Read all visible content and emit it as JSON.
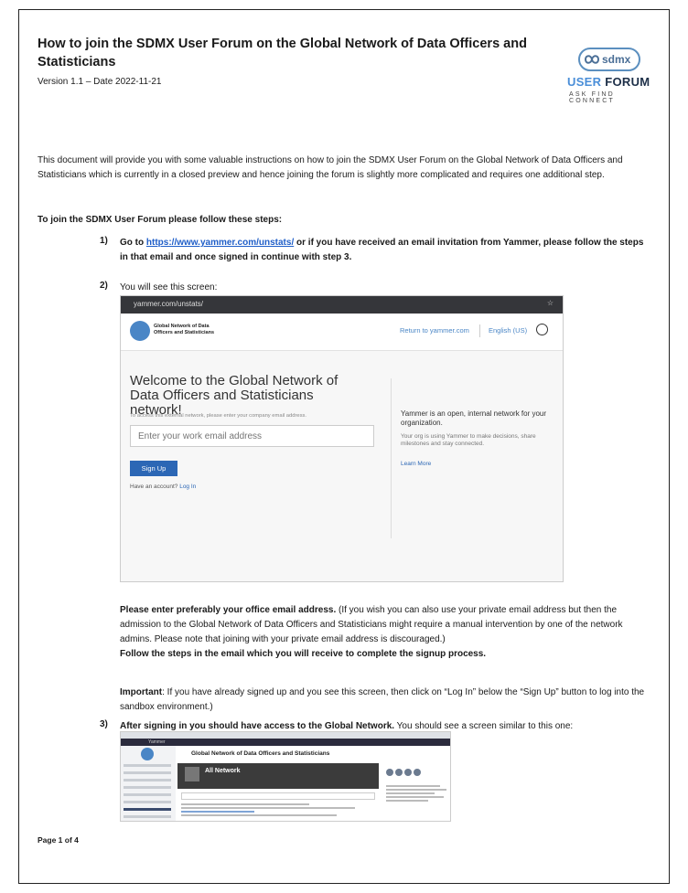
{
  "document": {
    "title": "How to join the SDMX User Forum on the Global Network of Data Officers and Statisticians",
    "version": "Version 1.1 – Date 2022-11-21",
    "logo": {
      "pill_text": "sdmx",
      "user_word": "USER",
      "forum_word": "FORUM",
      "tagline": "ASK FIND CONNECT",
      "accent_color": "#4a8ed8",
      "dark_color": "#1d2f48"
    },
    "intro": "This document will provide you with some valuable instructions on how to join the SDMX User Forum on the Global Network of Data Officers and Statisticians which is currently in a closed preview and hence joining the forum is slightly more complicated and requires one additional step.",
    "steps_heading": "To join the SDMX User Forum please follow these steps:",
    "step1": {
      "number": "1)",
      "lead": "Go to ",
      "link": "https://www.yammer.com/unstats/",
      "rest": " or if you have received an email invitation from Yammer, please follow the steps in that email and once signed in continue with step 3."
    },
    "step2": {
      "number": "2)",
      "text": "You will see this screen:"
    },
    "note": {
      "bold1": "Please enter preferably your office email address.",
      "normal": " (If you wish you can also use your private email address but then the admission to the Global Network of Data Officers and Statisticians might require a manual intervention by one of the network admins. Please note that joining with your private email address is discouraged.)",
      "bold2": "Follow the steps in the email which you will receive to complete the signup process."
    },
    "important": {
      "label": "Important",
      "text": ": If you have already signed up and you see this screen, then click on “Log In” below the “Sign Up” button to log into the sandbox environment.)"
    },
    "step3": {
      "number": "3)",
      "bold": "After signing in you should have access to the Global Network.",
      "rest": " You should see a screen similar to this one:"
    },
    "footer": "Page 1 of 4"
  },
  "screenshot1": {
    "url": "yammer.com/unstats/",
    "network_name_line1": "Global Network of Data",
    "network_name_line2": "Officers and Statisticians",
    "return_link": "Return to yammer.com",
    "language": "English (US)",
    "welcome": "Welcome to the Global Network of Data Officers and Statisticians network!",
    "access_text": "To access this external network, please enter your company email address.",
    "email_placeholder": "Enter your work email address",
    "signup_button": "Sign Up",
    "have_account": "Have an account? ",
    "login_link": "Log In",
    "yammer_desc": "Yammer is an open, internal network for your organization.",
    "yammer_sub": "Your org is using Yammer to make decisions, share milestones and stay connected.",
    "learn_more": "Learn More"
  },
  "screenshot2": {
    "app_name": "Yammer",
    "network_title": "Global Network of Data Officers and Statisticians",
    "group_name": "All Network"
  }
}
